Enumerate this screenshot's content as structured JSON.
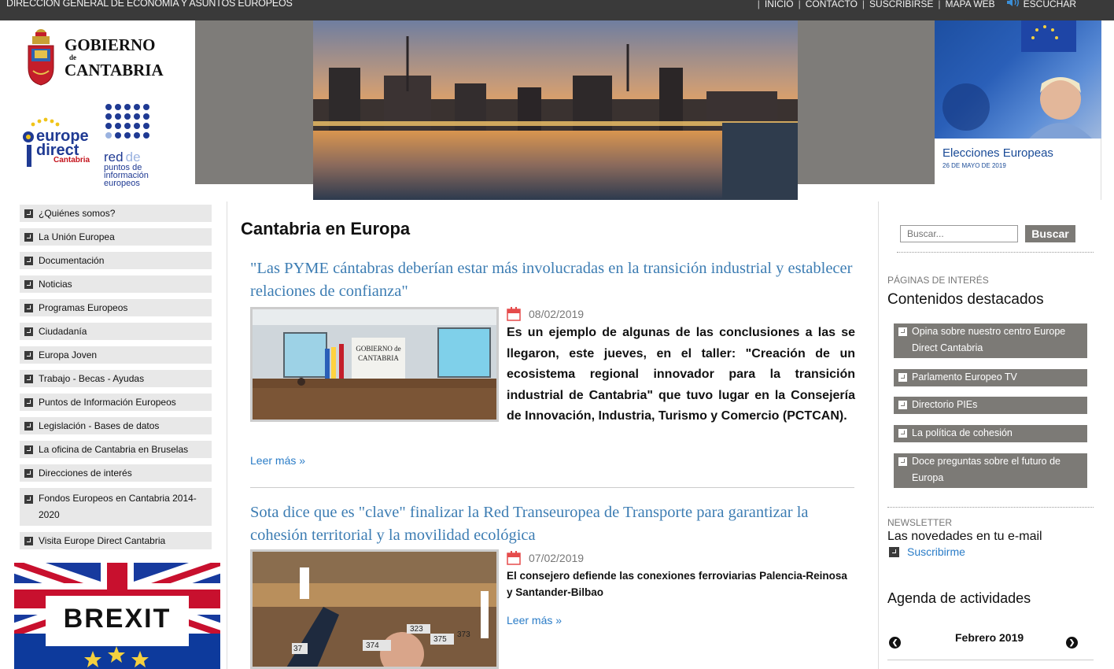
{
  "topbar": {
    "dept": "Dirección General de Economía y Asuntos Europeos",
    "links": [
      "INICIO",
      "CONTACTO",
      "SUSCRIBIRSE",
      "MAPA WEB"
    ],
    "listen": "ESCUCHAR"
  },
  "header": {
    "gov_line1": "GOBIERNO",
    "gov_de": "de",
    "gov_line2": "CANTABRIA",
    "ed_line1": "europe",
    "ed_line2": "direct",
    "ed_region": "Cantabria",
    "red_line1": "red",
    "red_line1b": "de",
    "red_line2": "puntos de",
    "red_line3": "información",
    "red_line4": "europeos",
    "elec_title": "Elecciones Europeas",
    "elec_date": "26 DE MAYO DE 2019"
  },
  "nav": [
    "¿Quiénes somos?",
    "La Unión Europea",
    "Documentación",
    "Noticias",
    "Programas Europeos",
    "Ciudadanía",
    "Europa Joven",
    "Trabajo - Becas - Ayudas",
    "Puntos de Información Europeos",
    "Legislación - Bases de datos",
    "La oficina de Cantabria en Bruselas",
    "Direcciones de interés",
    "Fondos Europeos en Cantabria 2014-2020",
    "Visita Europe Direct Cantabria"
  ],
  "brexit_label": "BREXIT",
  "main": {
    "title": "Cantabria en Europa",
    "articles": [
      {
        "title": "\"Las PYME cántabras deberían estar más involucradas en la transición industrial y establecer relaciones de confianza\"",
        "date": "08/02/2019",
        "summary": "Es un ejemplo de algunas de las conclusiones a las se llegaron, este jueves, en el taller: \"Creación de un ecosistema regional innovador para la transición industrial de Cantabria\" que tuvo lugar en la Consejería de Innovación, Industria, Turismo y Comercio (PCTCAN).",
        "more": "Leer más »"
      },
      {
        "title": "Sota dice que es \"clave\" finalizar la Red Transeuropea de Transporte para garantizar la cohesión territorial y la movilidad ecológica",
        "date": "07/02/2019",
        "summary": "El consejero defiende las conexiones ferroviarias Palencia-Reinosa y Santander-Bilbao",
        "more": "Leer más »"
      }
    ],
    "img1_sign": "GOBIERNO de CANTABRIA",
    "img2_labels": [
      "374",
      "375",
      "323",
      "373",
      "37"
    ]
  },
  "sidebar": {
    "search_placeholder": "Buscar...",
    "search_button": "Buscar",
    "interest_label": "PÁGINAS DE INTERÉS",
    "featured_title": "Contenidos destacados",
    "featured": [
      "Opina sobre nuestro centro Europe Direct Cantabria",
      "Parlamento Europeo TV",
      "Directorio PIEs",
      "La política de cohesión",
      "Doce preguntas sobre el futuro de Europa"
    ],
    "newsletter_label": "NEWSLETTER",
    "newsletter_text": "Las novedades en tu e-mail",
    "subscribe": "Suscribirme",
    "agenda_title": "Agenda de actividades",
    "agenda_month": "Febrero 2019"
  }
}
